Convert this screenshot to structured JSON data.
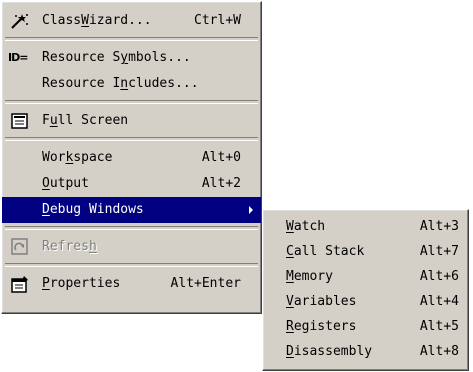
{
  "main_menu": {
    "items": [
      {
        "prefix": "Class",
        "mnemonic": "W",
        "suffix": "izard...",
        "accel": "Ctrl+W",
        "icon": "class-wizard-icon"
      },
      {
        "icon_text": "ID=",
        "prefix": "Resource S",
        "mnemonic": "y",
        "suffix": "mbols...",
        "accel": ""
      },
      {
        "prefix": "Resource I",
        "mnemonic": "n",
        "suffix": "cludes...",
        "accel": ""
      },
      {
        "prefix": "F",
        "mnemonic": "u",
        "suffix": "ll Screen",
        "accel": "",
        "icon": "full-screen-icon"
      },
      {
        "prefix": "Wor",
        "mnemonic": "k",
        "suffix": "space",
        "accel": "Alt+0"
      },
      {
        "prefix": "",
        "mnemonic": "O",
        "suffix": "utput",
        "accel": "Alt+2"
      },
      {
        "prefix": "",
        "mnemonic": "D",
        "suffix": "ebug Windows",
        "accel": "",
        "selected": true,
        "submenu_arrow": "submenu-arrow-icon"
      },
      {
        "prefix": "Refres",
        "mnemonic": "h",
        "suffix": "",
        "accel": "",
        "disabled": true,
        "icon": "refresh-icon"
      },
      {
        "prefix": "",
        "mnemonic": "P",
        "suffix": "roperties",
        "accel": "Alt+Enter",
        "icon": "properties-icon"
      }
    ]
  },
  "debug_windows_submenu": {
    "items": [
      {
        "prefix": "",
        "mnemonic": "W",
        "suffix": "atch",
        "accel": "Alt+3"
      },
      {
        "prefix": "",
        "mnemonic": "C",
        "suffix": "all Stack",
        "accel": "Alt+7"
      },
      {
        "prefix": "",
        "mnemonic": "M",
        "suffix": "emory",
        "accel": "Alt+6"
      },
      {
        "prefix": "",
        "mnemonic": "V",
        "suffix": "ariables",
        "accel": "Alt+4"
      },
      {
        "prefix": "",
        "mnemonic": "R",
        "suffix": "egisters",
        "accel": "Alt+5"
      },
      {
        "prefix": "",
        "mnemonic": "D",
        "suffix": "isassembly",
        "accel": "Alt+8"
      }
    ]
  },
  "colors": {
    "menu_face": "#d4d0c8",
    "highlight": "#000080",
    "highlight_text": "#ffffff",
    "disabled_text": "#808080"
  }
}
